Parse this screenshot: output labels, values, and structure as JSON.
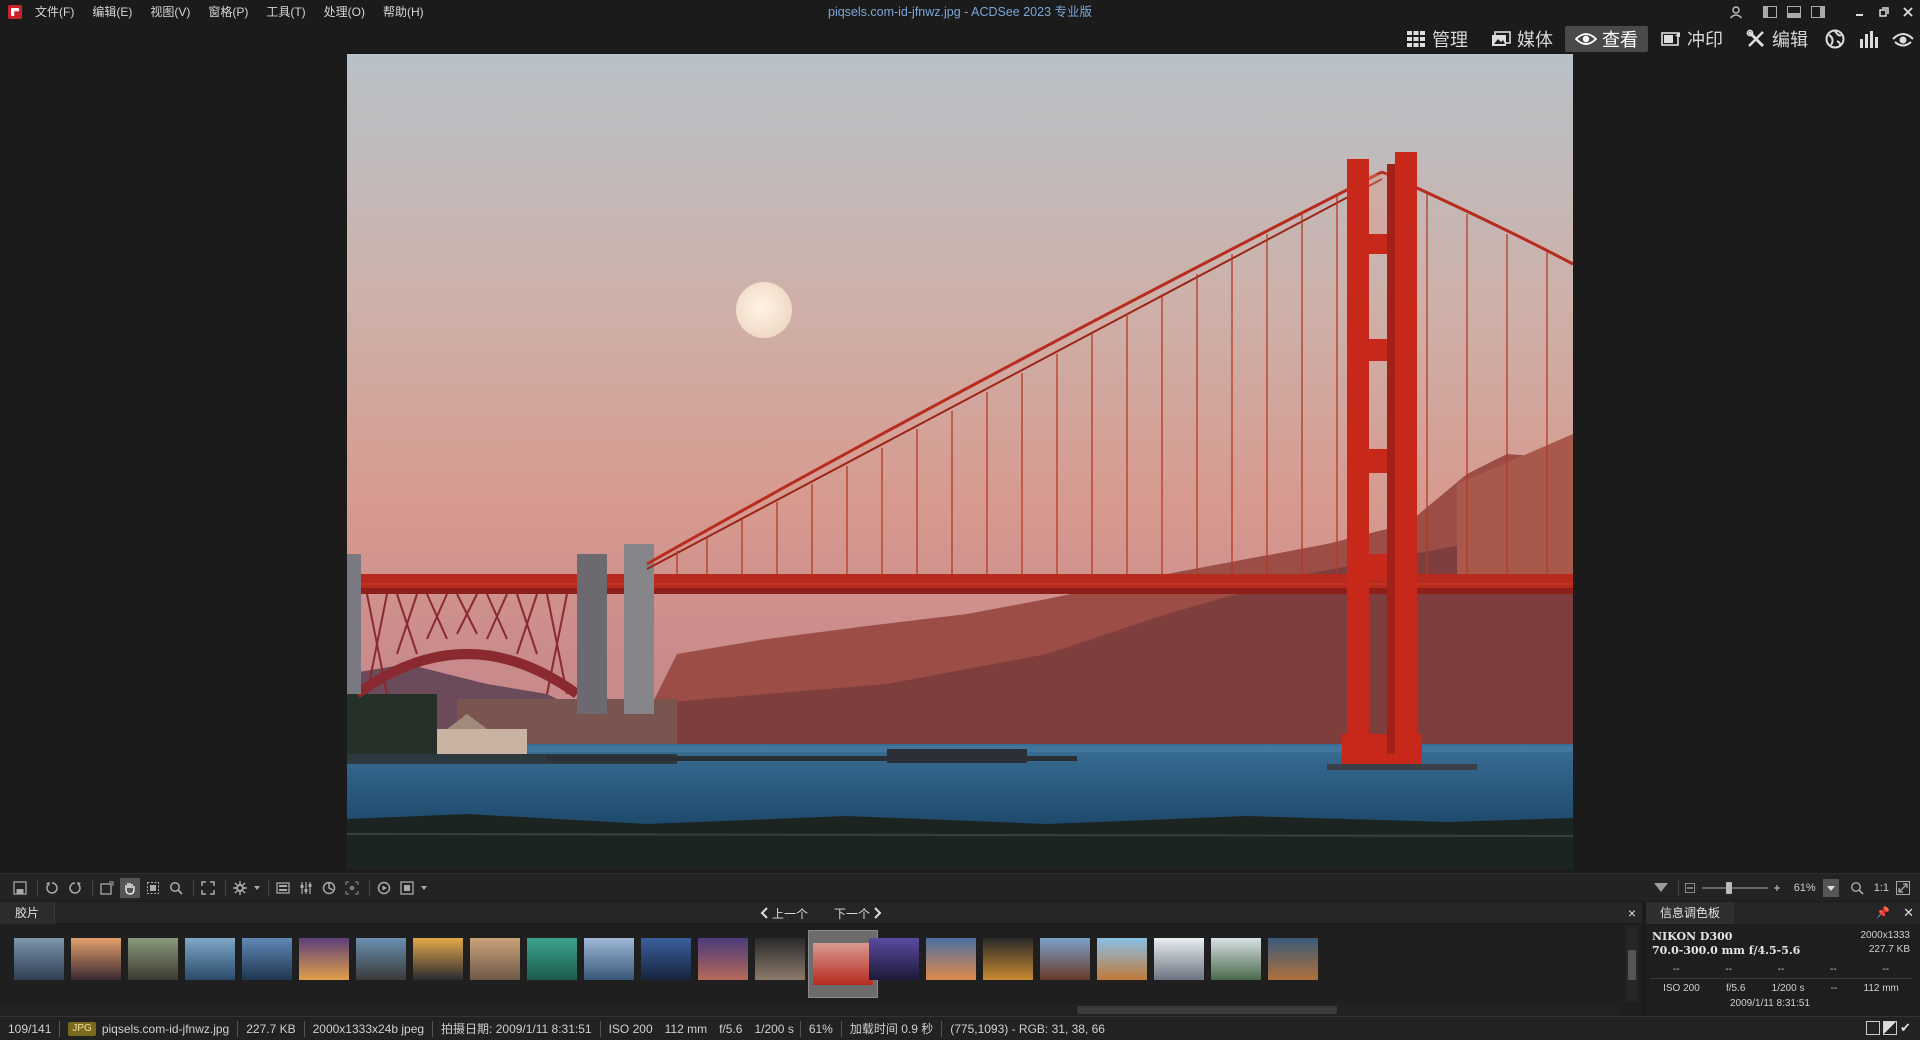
{
  "menu": [
    "文件(F)",
    "编辑(E)",
    "视图(V)",
    "窗格(P)",
    "工具(T)",
    "处理(O)",
    "帮助(H)"
  ],
  "window_title": "piqsels.com-id-jfnwz.jpg - ACDSee 2023 专业版",
  "modes": [
    {
      "label": "管理",
      "icon": "grid-icon"
    },
    {
      "label": "媒体",
      "icon": "media-icon"
    },
    {
      "label": "查看",
      "icon": "eye-icon",
      "active": true
    },
    {
      "label": "冲印",
      "icon": "develop-icon"
    },
    {
      "label": "编辑",
      "icon": "edit-tools-icon"
    }
  ],
  "toolbar": {
    "zoom_value": "61%",
    "zoom_ratio": "1:1"
  },
  "filmstrip": {
    "tab_label": "胶片",
    "prev_label": "上一个",
    "next_label": "下一个",
    "close_label": "×"
  },
  "info_panel": {
    "tab_label": "信息调色板",
    "camera": "NIKON D300",
    "lens": "70.0-300.0 mm f/4.5-5.6",
    "dimensions": "2000x1333",
    "filesize": "227.7 KB",
    "row1": [
      "--",
      "--",
      "--",
      "--",
      "--"
    ],
    "row2": [
      "ISO 200",
      "f/5.6",
      "1/200 s",
      "--",
      "112 mm"
    ],
    "date": "2009/1/11 8:31:51"
  },
  "status": {
    "index": "109/141",
    "badge": "JPG",
    "filename": "piqsels.com-id-jfnwz.jpg",
    "filesize": "227.7 KB",
    "format": "2000x1333x24b jpeg",
    "taken": "拍摄日期: 2009/1/11 8:31:51",
    "iso": "ISO 200",
    "focal": "112 mm",
    "aperture": "f/5.6",
    "shutter": "1/200 s",
    "zoom": "61%",
    "load_time": "加载时间 0.9 秒",
    "pixel": "(775,1093) - RGB: 31, 38, 66"
  },
  "colors": {
    "accent_title": "#7aa6d8",
    "bridge_red": "#c7281a",
    "sky_top": "#b9c2c9",
    "sky_bottom": "#d99a92"
  }
}
